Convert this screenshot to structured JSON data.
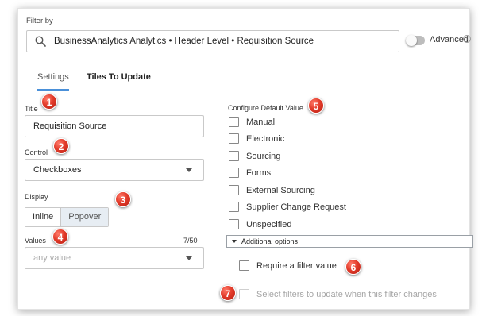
{
  "filter": {
    "label": "Filter by",
    "search_value": "BusinessAnalytics Analytics • Header Level • Requisition Source",
    "advanced_label": "Advanced",
    "info_glyph": "i"
  },
  "tabs": [
    {
      "label": "Settings"
    },
    {
      "label": "Tiles To Update"
    }
  ],
  "settings": {
    "title_label": "Title",
    "title_value": "Requisition Source",
    "control_label": "Control",
    "control_value": "Checkboxes",
    "display_label": "Display",
    "display_options": [
      "Inline",
      "Popover"
    ],
    "values_label": "Values",
    "values_count": "7/50",
    "values_placeholder": "any value"
  },
  "default_value": {
    "label": "Configure Default Value",
    "options": [
      "Manual",
      "Electronic",
      "Sourcing",
      "Forms",
      "External Sourcing",
      "Supplier Change Request",
      "Unspecified"
    ]
  },
  "additional": {
    "label": "Additional options",
    "require_label": "Require a filter value",
    "select_filters_label": "Select filters to update when this filter changes"
  },
  "markers": [
    "1",
    "2",
    "3",
    "4",
    "5",
    "6",
    "7"
  ],
  "colors": {
    "accent_tab_underline": "#4a90d9",
    "marker_red": "#e23b2a"
  }
}
